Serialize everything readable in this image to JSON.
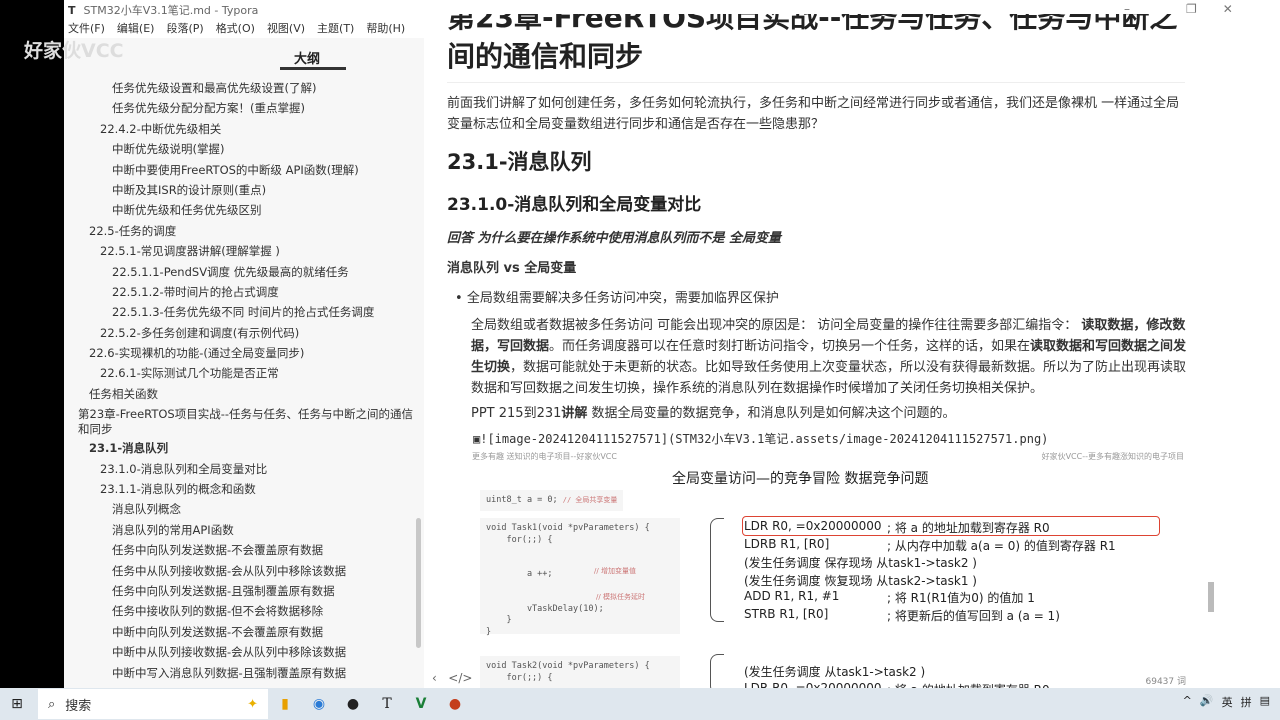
{
  "watermark": "好家伙VCC",
  "window": {
    "title": "STM32小车V3.1笔记.md - Typora",
    "app_icon": "T",
    "controls": [
      "–",
      "❐",
      "✕"
    ]
  },
  "menu": [
    "文件(F)",
    "编辑(E)",
    "段落(P)",
    "格式(O)",
    "视图(V)",
    "主题(T)",
    "帮助(H)"
  ],
  "sidebar": {
    "tab": "大纲",
    "items": [
      {
        "label": "任务优先级设置和最高优先级设置(了解)",
        "level": 4
      },
      {
        "label": "任务优先级分配分配方案！(重点掌握)",
        "level": 4
      },
      {
        "label": "22.4.2-中断优先级相关",
        "level": 3
      },
      {
        "label": "中断优先级说明(掌握)",
        "level": 4
      },
      {
        "label": "中断中要使用FreeRTOS的中断级 API函数(理解)",
        "level": 4
      },
      {
        "label": "中断及其ISR的设计原则(重点)",
        "level": 4
      },
      {
        "label": "中断优先级和任务优先级区别",
        "level": 4
      },
      {
        "label": "22.5-任务的调度",
        "level": 2
      },
      {
        "label": "22.5.1-常见调度器讲解(理解掌握 )",
        "level": 3
      },
      {
        "label": "22.5.1.1-PendSV调度 优先级最高的就绪任务",
        "level": 4
      },
      {
        "label": "22.5.1.2-带时间片的抢占式调度",
        "level": 4
      },
      {
        "label": "22.5.1.3-任务优先级不同 时间片的抢占式任务调度",
        "level": 4
      },
      {
        "label": "22.5.2-多任务创建和调度(有示例代码)",
        "level": 3
      },
      {
        "label": "22.6-实现裸机的功能-(通过全局变量同步)",
        "level": 2
      },
      {
        "label": "22.6.1-实际测试几个功能是否正常",
        "level": 3
      },
      {
        "label": "任务相关函数",
        "level": 2
      },
      {
        "label": "第23章-FreeRTOS项目实战--任务与任务、任务与中断之间的通信和同步",
        "level": 1
      },
      {
        "label": "23.1-消息队列",
        "level": 2,
        "active": true
      },
      {
        "label": "23.1.0-消息队列和全局变量对比",
        "level": 3
      },
      {
        "label": "23.1.1-消息队列的概念和函数",
        "level": 3
      },
      {
        "label": "消息队列概念",
        "level": 4
      },
      {
        "label": "消息队列的常用API函数",
        "level": 4
      },
      {
        "label": "任务中向队列发送数据-不会覆盖原有数据",
        "level": 4
      },
      {
        "label": "任务中从队列接收数据-会从队列中移除该数据",
        "level": 4
      },
      {
        "label": "任务中向队列发送数据-且强制覆盖原有数据",
        "level": 4
      },
      {
        "label": "任务中接收队列的数据-但不会将数据移除",
        "level": 4
      },
      {
        "label": "中断中向队列发送数据-不会覆盖原有数据",
        "level": 4
      },
      {
        "label": "中断中从队列接收数据-会从队列中移除该数据",
        "level": 4
      },
      {
        "label": "中断中写入消息队列数据-且强制覆盖原有数据",
        "level": 4
      }
    ]
  },
  "doc": {
    "h1_line1": "第23章-FreeRTOS项目实战--任务与任务、任务与中断之",
    "h1_line2": "间的通信和同步",
    "intro": "前面我们讲解了如何创建任务，多任务如何轮流执行，多任务和中断之间经常进行同步或者通信，我们还是像裸机 一样通过全局变量标志位和全局变量数组进行同步和通信是否存在一些隐患那？",
    "h2": "23.1-消息队列",
    "h3": "23.1.0-消息队列和全局变量对比",
    "question": "回答 为什么要在操作系统中使用消息队列而不是 全局变量",
    "compare": "消息队列 vs 全局变量",
    "bullet": "全局数组需要解决多任务访问冲突，需要加临界区保护",
    "para": [
      {
        "t": "全局数组或者数据被多任务访问 可能会出现冲突的原因是： 访问全局变量的操作往往需要多部汇编指令： "
      },
      {
        "t": "读取数据，修改数据，写回数据",
        "b": true
      },
      {
        "t": "。而任务调度器可以在任意时刻打断访问指令，切换另一个任务，这样的话，如果在"
      },
      {
        "t": "读取数据和写回数据之间发生切换",
        "b": true
      },
      {
        "t": "，数据可能就处于未更新的状态。比如导致任务使用上次变量状态，所以没有获得最新数据。所以为了防止出现再读取数据和写回数据之间发生切换，操作系统的消息队列在数据操作时候增加了关闭任务切换相关保护。"
      }
    ],
    "ppt_a": "PPT 215到231",
    "ppt_b": "讲解",
    "ppt_c": " 数据全局变量的数据竞争，和消息队列是如何解决这个问题的。",
    "image_md": "![image-20241204111527571](STM32小车V3.1笔记.assets/image-20241204111527571.png)",
    "image": {
      "wm_left": "更多有趣 送知识的电子项目--好家伙VCC",
      "wm_right": "好家伙VCC--更多有趣涨知识的电子项目",
      "title": "全局变量访问—的竞争冒险 数据竞争问题",
      "code0": "uint8_t a = 0; ",
      "code0_c": "// 全局共享变量",
      "task1": [
        "void Task1(void *pvParameters) {",
        "    for(;;) {",
        "",
        "",
        "        a ++;",
        "",
        "",
        "        vTaskDelay(10);",
        "    }",
        "}"
      ],
      "task1_c1": "// 增加变量值",
      "task1_c2": "// 模拟任务延时",
      "task2": [
        "void Task2(void *pvParameters) {",
        "    for(;;) {"
      ],
      "asm": [
        {
          "i": " LDR R0, =0x20000000",
          "c": "; 将 a 的地址加载到寄存器 R0"
        },
        {
          "i": " LDRB R1, [R0]",
          "c": "; 从内存中加载 a(a = 0) 的值到寄存器 R1"
        },
        {
          "i": "(发生任务调度 保存现场 从task1->task2 )",
          "c": ""
        },
        {
          "i": "(发生任务调度 恢复现场 从task2->task1 )",
          "c": ""
        },
        {
          "i": " ADD R1, R1, #1",
          "c": "; 将 R1(R1值为0) 的值加 1"
        },
        {
          "i": " STRB R1, [R0]",
          "c": "; 将更新后的值写回到 a (a = 1)"
        }
      ],
      "asm2": [
        {
          "i": "(发生任务调度 从task1->task2 )",
          "c": ""
        },
        {
          "i": " LDR R0, =0x20000000",
          "c": "; 将 a 的地址加载到寄存器 R0"
        }
      ]
    }
  },
  "footer": {
    "back": "‹",
    "source": "</>",
    "wordcount": "69437 词"
  },
  "taskbar": {
    "search": "搜索",
    "apps": [
      "文件资源管理器",
      "浏览器",
      "OBS",
      "Typora",
      "编辑器",
      "PowerPoint"
    ],
    "tray": [
      "^",
      "英",
      "拼"
    ]
  }
}
